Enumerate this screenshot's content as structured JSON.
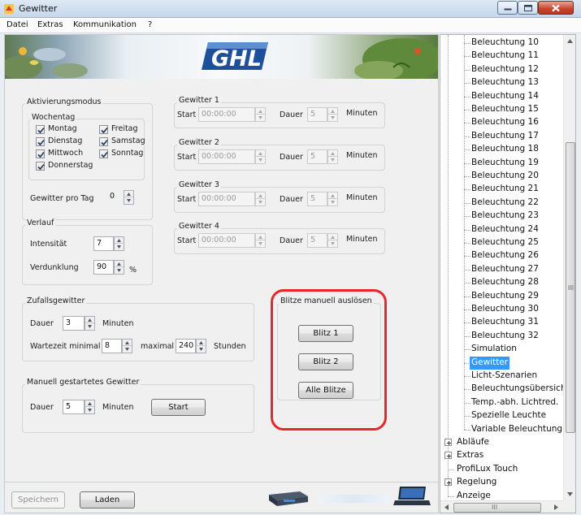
{
  "window": {
    "title": "Gewitter"
  },
  "menu": [
    "Datei",
    "Extras",
    "Kommunikation",
    "?"
  ],
  "brand": {
    "logo_text": "GHL",
    "accent": "#1d4f9a"
  },
  "activation": {
    "legend": "Aktivierungsmodus",
    "weekday_legend": "Wochentag",
    "days": [
      {
        "label": "Montag",
        "checked": true
      },
      {
        "label": "Dienstag",
        "checked": true
      },
      {
        "label": "Mittwoch",
        "checked": true
      },
      {
        "label": "Donnerstag",
        "checked": true
      },
      {
        "label": "Freitag",
        "checked": true
      },
      {
        "label": "Samstag",
        "checked": true
      },
      {
        "label": "Sonntag",
        "checked": true
      }
    ],
    "per_day_label": "Gewitter pro Tag",
    "per_day_value": "0"
  },
  "course": {
    "legend": "Verlauf",
    "intensity_label": "Intensität",
    "intensity_value": "7",
    "darkening_label": "Verdunklung",
    "darkening_value": "90",
    "darkening_unit": "%"
  },
  "storms": [
    {
      "title": "Gewitter 1",
      "start_label": "Start",
      "start": "00:00:00",
      "duration_label": "Dauer",
      "duration": "5",
      "unit": "Minuten"
    },
    {
      "title": "Gewitter 2",
      "start_label": "Start",
      "start": "00:00:00",
      "duration_label": "Dauer",
      "duration": "5",
      "unit": "Minuten"
    },
    {
      "title": "Gewitter 3",
      "start_label": "Start",
      "start": "00:00:00",
      "duration_label": "Dauer",
      "duration": "5",
      "unit": "Minuten"
    },
    {
      "title": "Gewitter 4",
      "start_label": "Start",
      "start": "00:00:00",
      "duration_label": "Dauer",
      "duration": "5",
      "unit": "Minuten"
    }
  ],
  "random": {
    "legend": "Zufallsgewitter",
    "duration_label": "Dauer",
    "duration": "3",
    "duration_unit": "Minuten",
    "wait_label": "Wartezeit minimal",
    "wait_min": "8",
    "max_label": "maximal",
    "wait_max": "240",
    "wait_unit": "Stunden"
  },
  "manual": {
    "legend": "Manuell gestartetes Gewitter",
    "duration_label": "Dauer",
    "duration": "5",
    "unit": "Minuten",
    "start_button": "Start"
  },
  "flashes": {
    "legend": "Blitze manuell auslösen",
    "buttons": [
      "Blitz 1",
      "Blitz 2",
      "Alle Blitze"
    ],
    "highlight_color": "#e8262b"
  },
  "footer": {
    "save": "Speichern",
    "load": "Laden"
  },
  "tree": {
    "children": [
      "Beleuchtung 10",
      "Beleuchtung 11",
      "Beleuchtung 12",
      "Beleuchtung 13",
      "Beleuchtung 14",
      "Beleuchtung 15",
      "Beleuchtung 16",
      "Beleuchtung 17",
      "Beleuchtung 18",
      "Beleuchtung 19",
      "Beleuchtung 20",
      "Beleuchtung 21",
      "Beleuchtung 22",
      "Beleuchtung 23",
      "Beleuchtung 24",
      "Beleuchtung 25",
      "Beleuchtung 26",
      "Beleuchtung 27",
      "Beleuchtung 28",
      "Beleuchtung 29",
      "Beleuchtung 30",
      "Beleuchtung 31",
      "Beleuchtung 32",
      "Simulation",
      "Gewitter",
      "Licht-Szenarien",
      "Beleuchtungsübersicht",
      "Temp.-abh. Lichtred.",
      "Spezielle Leuchte",
      "Variable Beleuchtung"
    ],
    "selected": "Gewitter",
    "roots": [
      {
        "label": "Abläufe",
        "expandable": true
      },
      {
        "label": "Extras",
        "expandable": true
      },
      {
        "label": "ProfiLux Touch",
        "expandable": false
      },
      {
        "label": "Regelung",
        "expandable": true
      },
      {
        "label": "Anzeige",
        "expandable": false
      }
    ],
    "hscroll_grip": "III"
  }
}
